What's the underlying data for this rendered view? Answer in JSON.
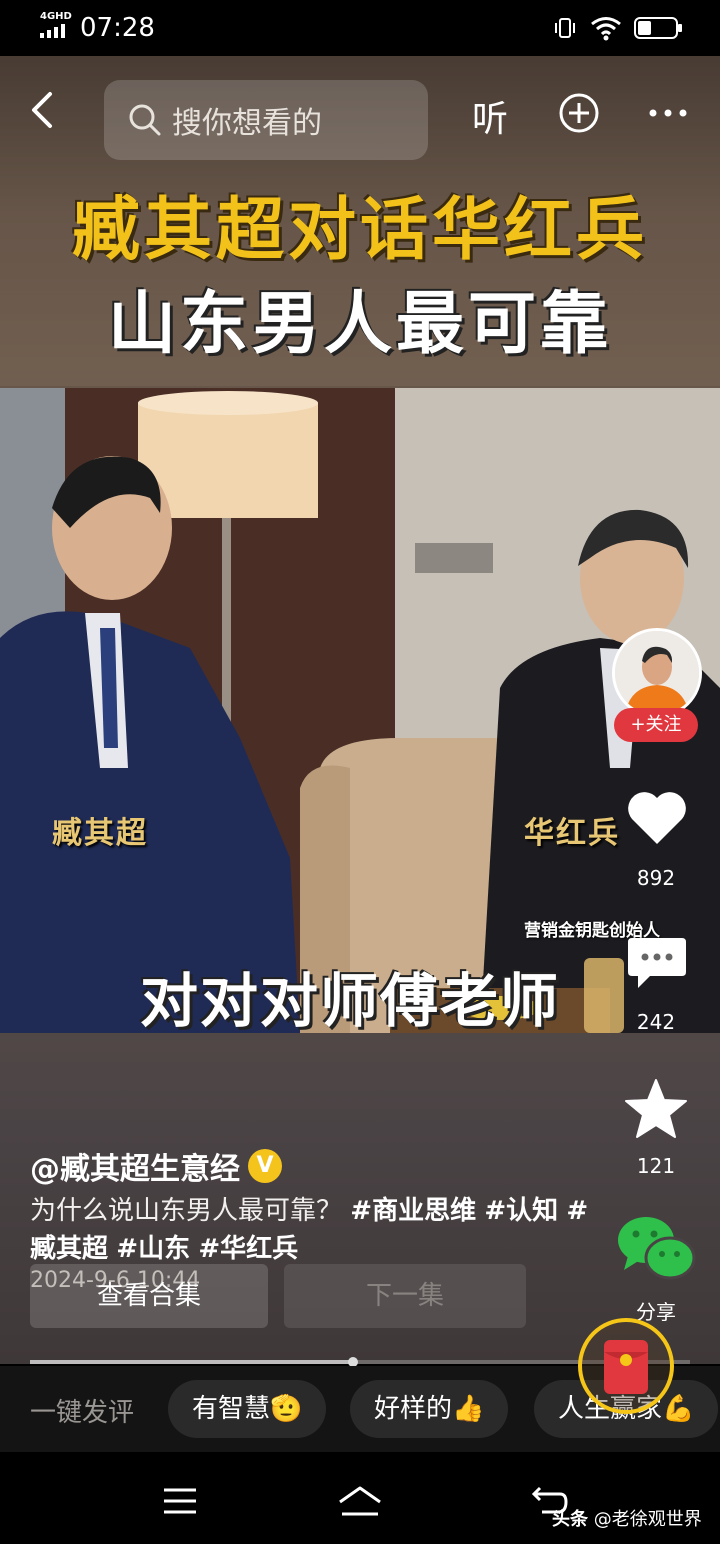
{
  "status_bar": {
    "network": "4GHD",
    "time": "07:28"
  },
  "top_nav": {
    "search_placeholder": "搜你想看的",
    "listen_label": "听"
  },
  "video": {
    "title_line1": "臧其超对话华红兵",
    "title_line2": "山东男人最可靠",
    "name_left": "臧其超",
    "name_right": "华红兵",
    "name_right_sub": "营销金钥匙创始人",
    "subtitle": "对对对师傅老师"
  },
  "author": {
    "name": "@臧其超生意经",
    "follow_label": "+关注",
    "verified_mark": "V"
  },
  "actions": {
    "likes": "892",
    "comments": "242",
    "favorites": "121",
    "share_label": "分享"
  },
  "caption": {
    "text": "为什么说山东男人最可靠？",
    "tags": [
      "#商业思维",
      "#认知",
      "#臧其超",
      "#山东",
      "#华红兵"
    ],
    "date": "2024-9-6 10:44"
  },
  "buttons": {
    "collection": "查看合集",
    "next": "下一集"
  },
  "progress": {
    "fraction": 0.49
  },
  "comment_bar": {
    "label": "一键发评",
    "chips": [
      "有智慧🫡",
      "好样的👍",
      "人生赢家💪"
    ]
  },
  "watermark": {
    "brand": "头条",
    "handle": "@老徐观世界"
  },
  "colors": {
    "title_yellow": "#f2c21b",
    "follow_red": "#e0383e",
    "wechat_green": "#2ec04a",
    "redpacket_ring": "#f5c518"
  }
}
